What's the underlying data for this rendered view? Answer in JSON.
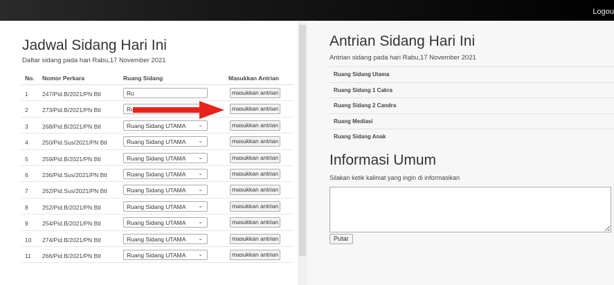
{
  "topbar": {
    "logout_label": "Logou"
  },
  "left": {
    "title": "Jadwal Sidang Hari Ini",
    "subtitle": "Daftar sidang pada hari Rabu,17 November 2021",
    "columns": [
      "No.",
      "Nomor Perkara",
      "Ruang Sidang",
      "Masukkan Antrian"
    ],
    "rows": [
      {
        "no": "1",
        "perkara": "247/Pid.B/2021/PN Btl",
        "ruang": "Ru",
        "action": "masukkan antrian"
      },
      {
        "no": "2",
        "perkara": "273/Pid.B/2021/PN Btl",
        "ruang": "Ruang Sidang UTAMA",
        "action": "masukkan antrian"
      },
      {
        "no": "3",
        "perkara": "268/Pid.B/2021/PN Btl",
        "ruang": "Ruang Sidang UTAMA",
        "action": "masukkan antrian"
      },
      {
        "no": "4",
        "perkara": "250/Pid.Sus/2021/PN Btl",
        "ruang": "Ruang Sidang UTAMA",
        "action": "masukkan antrian"
      },
      {
        "no": "5",
        "perkara": "259/Pid.B/2021/PN Btl",
        "ruang": "Ruang Sidang UTAMA",
        "action": "masukkan antrian"
      },
      {
        "no": "6",
        "perkara": "236/Pid.Sus/2021/PN Btl",
        "ruang": "Ruang Sidang UTAMA",
        "action": "masukkan antrian"
      },
      {
        "no": "7",
        "perkara": "262/Pid.Sus/2021/PN Btl",
        "ruang": "Ruang Sidang UTAMA",
        "action": "masukkan antrian"
      },
      {
        "no": "8",
        "perkara": "252/Pid.B/2021/PN Btl",
        "ruang": "Ruang Sidang UTAMA",
        "action": "masukkan antrian"
      },
      {
        "no": "9",
        "perkara": "254/Pid.B/2021/PN Btl",
        "ruang": "Ruang Sidang UTAMA",
        "action": "masukkan antrian"
      },
      {
        "no": "10",
        "perkara": "274/Pid.B/2021/PN Btl",
        "ruang": "Ruang Sidang UTAMA",
        "action": "masukkan antrian"
      },
      {
        "no": "11",
        "perkara": "266/Pid.B/2021/PN Btl",
        "ruang": "Ruang Sidang UTAMA",
        "action": "masukkan antrian"
      }
    ],
    "arrow_color": "#e8231c"
  },
  "right": {
    "title": "Antrian Sidang Hari Ini",
    "subtitle": "Antrian sidang pada hari Rabu,17 November 2021",
    "rooms": [
      "Ruang Sidang Utama",
      "Ruang Sidang 1 Cakra",
      "Ruang Sidang 2 Candra",
      "Ruang Mediasi",
      "Ruang Sidang Anak"
    ],
    "info_title": "Informasi Umum",
    "info_subtitle": "Silakan ketik kalimat yang ingin di informasikan",
    "textarea_value": "",
    "putar_label": "Putar"
  }
}
